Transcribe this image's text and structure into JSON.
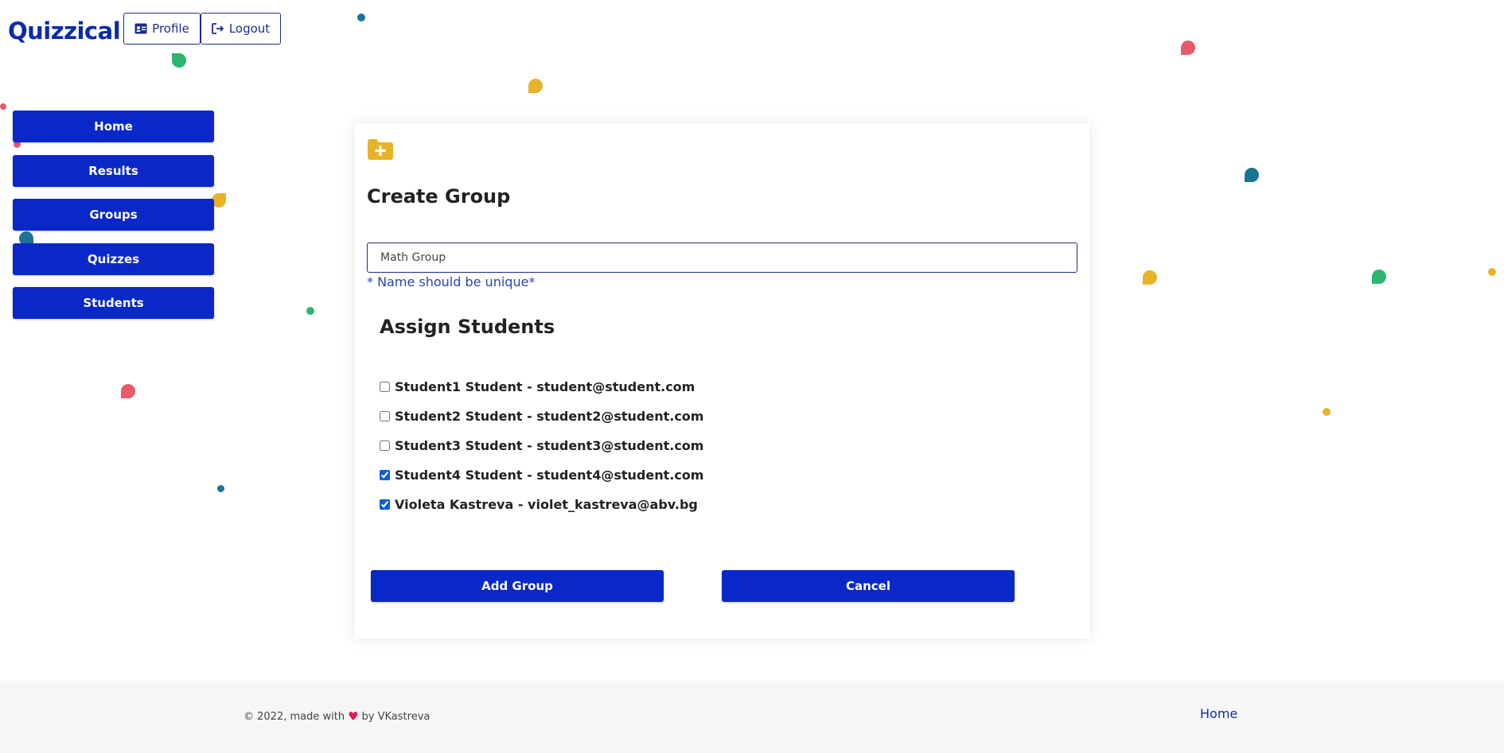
{
  "header": {
    "brand": "Quizzical",
    "profile_label": "Profile",
    "logout_label": "Logout"
  },
  "sidebar": {
    "items": [
      {
        "label": "Home"
      },
      {
        "label": "Results"
      },
      {
        "label": "Groups"
      },
      {
        "label": "Quizzes"
      },
      {
        "label": "Students"
      }
    ]
  },
  "form": {
    "title": "Create Group",
    "name_value": "Math Group",
    "name_hint": "* Name should be unique*",
    "assign_title": "Assign Students",
    "students": [
      {
        "label": "Student1 Student - student@student.com",
        "checked": false
      },
      {
        "label": "Student2 Student - student2@student.com",
        "checked": false
      },
      {
        "label": "Student3 Student - student3@student.com",
        "checked": false
      },
      {
        "label": "Student4 Student - student4@student.com",
        "checked": true
      },
      {
        "label": "Violeta Kastreva - violet_kastreva@abv.bg",
        "checked": true
      }
    ],
    "add_label": "Add Group",
    "cancel_label": "Cancel"
  },
  "footer": {
    "prefix": "© 2022, made with",
    "suffix": "by VKastreva",
    "home_link": "Home"
  },
  "colors": {
    "accent": "#0a28c8",
    "brand": "#0d2aa9",
    "folder": "#e8b32a",
    "heart": "#e21a4f"
  },
  "icons": {
    "profile": "id-card-icon",
    "logout": "sign-out-icon",
    "folder": "folder-plus-icon",
    "heart": "heart-icon"
  }
}
